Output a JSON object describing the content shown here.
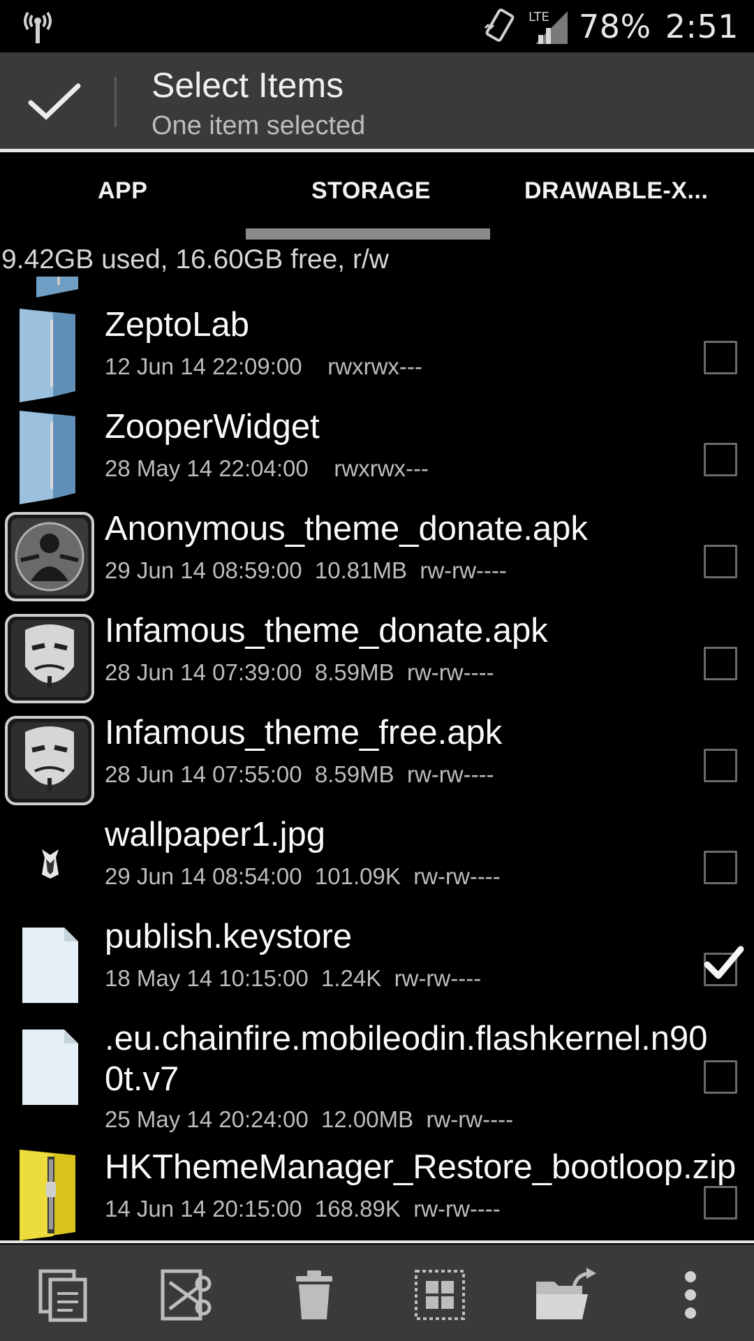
{
  "status_bar": {
    "battery": "78%",
    "time": "2:51",
    "network_label": "LTE"
  },
  "action_bar": {
    "title": "Select Items",
    "subtitle": "One item selected"
  },
  "tabs": [
    {
      "label": "APP",
      "active": false
    },
    {
      "label": "STORAGE",
      "active": true
    },
    {
      "label": "DRAWABLE-X..."
    }
  ],
  "storage_info": "9.42GB used, 16.60GB free, r/w",
  "files": [
    {
      "name": "ZeptoLab",
      "meta": "12 Jun 14 22:09:00    rwxrwx---",
      "icon": "folder-icon",
      "checked": false
    },
    {
      "name": "ZooperWidget",
      "meta": "28 May 14 22:04:00    rwxrwx---",
      "icon": "folder-icon",
      "checked": false
    },
    {
      "name": "Anonymous_theme_donate.apk",
      "meta": "29 Jun 14 08:59:00  10.81MB  rw-rw----",
      "icon": "anonymous-app-icon",
      "checked": false
    },
    {
      "name": "Infamous_theme_donate.apk",
      "meta": "28 Jun 14 07:39:00  8.59MB  rw-rw----",
      "icon": "mask-app-icon",
      "checked": false
    },
    {
      "name": "Infamous_theme_free.apk",
      "meta": "28 Jun 14 07:55:00  8.59MB  rw-rw----",
      "icon": "mask-app-icon",
      "checked": false
    },
    {
      "name": "wallpaper1.jpg",
      "meta": "29 Jun 14 08:54:00  101.09K  rw-rw----",
      "icon": "image-thumbnail-icon",
      "checked": false
    },
    {
      "name": "publish.keystore",
      "meta": "18 May 14 10:15:00  1.24K  rw-rw----",
      "icon": "file-icon",
      "checked": true
    },
    {
      "name": ".eu.chainfire.mobileodin.flashkernel.n900t.v7",
      "name_line1": ".eu.chainfire.mobileodin.flashkernel.n90",
      "name_line2": "0t.v7",
      "meta": "25 May 14 20:24:00  12.00MB  rw-rw----",
      "icon": "file-icon",
      "checked": false
    },
    {
      "name": "HKThemeManager_Restore_bootloop.zip",
      "meta": "14 Jun 14 20:15:00  168.89K  rw-rw----",
      "icon": "zip-icon",
      "checked": false
    }
  ],
  "toolbar": [
    {
      "icon": "copy-icon"
    },
    {
      "icon": "cut-icon"
    },
    {
      "icon": "delete-icon"
    },
    {
      "icon": "select-all-icon"
    },
    {
      "icon": "move-to-folder-icon"
    },
    {
      "icon": "overflow-menu-icon"
    }
  ]
}
